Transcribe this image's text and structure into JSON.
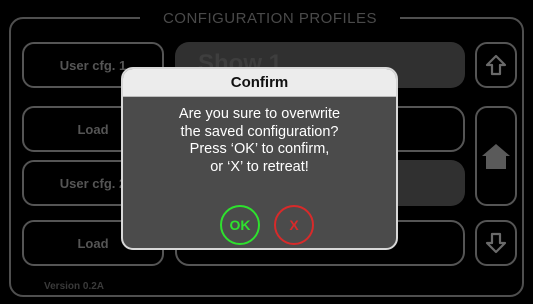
{
  "header": {
    "title": "CONFIGURATION PROFILES"
  },
  "profiles": [
    {
      "name": "User cfg. 1",
      "load_label": "Load"
    },
    {
      "name": "User cfg. 2",
      "load_label": "Load"
    }
  ],
  "preview": {
    "show_label": "Show 1"
  },
  "navigation": {
    "up_icon": "arrow-up-icon",
    "home_icon": "home-icon",
    "down_icon": "arrow-down-icon"
  },
  "footer": {
    "version": "Version 0.2A"
  },
  "dialog": {
    "title": "Confirm",
    "message_lines": [
      "Are you sure to overwrite",
      "the saved configuration?",
      "Press ‘OK’ to confirm,",
      "or ‘X’ to retreat!"
    ],
    "ok_label": "OK",
    "cancel_label": "X"
  },
  "colors": {
    "ok": "#2ee12e",
    "cancel": "#d82a2a",
    "dialog_bg": "#4b4b4b",
    "dialog_title_bg": "#ececec"
  }
}
